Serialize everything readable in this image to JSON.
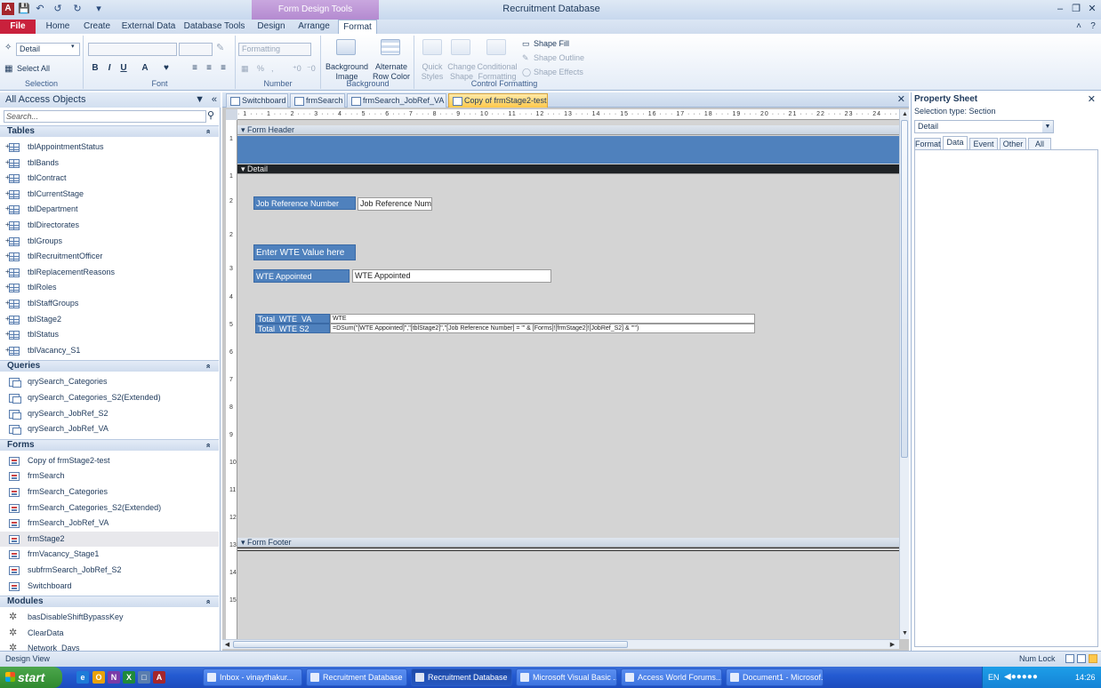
{
  "window": {
    "title": "Recruitment Database",
    "app_icon": "A",
    "context_group": "Form Design Tools"
  },
  "ribbon_tabs": [
    "File",
    "Home",
    "Create",
    "External Data",
    "Database Tools",
    "Design",
    "Arrange",
    "Format"
  ],
  "ribbon": {
    "selection": {
      "label": "Selection",
      "object_combo": "Detail",
      "select_all": "Select All"
    },
    "font": {
      "label": "Font"
    },
    "number": {
      "label": "Number",
      "format_combo": "Formatting"
    },
    "background": {
      "label": "Background",
      "background_image": "Background\nImage",
      "alternate_row_color": "Alternate\nRow Color"
    },
    "control_formatting": {
      "label": "Control Formatting",
      "quick_styles": "Quick\nStyles",
      "change_shape": "Change\nShape",
      "conditional_formatting": "Conditional\nFormatting",
      "shape_fill": "Shape Fill",
      "shape_outline": "Shape Outline",
      "shape_effects": "Shape Effects"
    }
  },
  "nav": {
    "header": "All Access Objects",
    "search_placeholder": "Search...",
    "groups": [
      {
        "title": "Tables",
        "type": "table",
        "items": [
          "tblAppointmentStatus",
          "tblBands",
          "tblContract",
          "tblCurrentStage",
          "tblDepartment",
          "tblDirectorates",
          "tblGroups",
          "tblRecruitmentOfficer",
          "tblReplacementReasons",
          "tblRoles",
          "tblStaffGroups",
          "tblStage2",
          "tblStatus",
          "tblVacancy_S1"
        ]
      },
      {
        "title": "Queries",
        "type": "query",
        "items": [
          "qrySearch_Categories",
          "qrySearch_Categories_S2(Extended)",
          "qrySearch_JobRef_S2",
          "qrySearch_JobRef_VA"
        ]
      },
      {
        "title": "Forms",
        "type": "form",
        "items": [
          "Copy of frmStage2-test",
          "frmSearch",
          "frmSearch_Categories",
          "frmSearch_Categories_S2(Extended)",
          "frmSearch_JobRef_VA",
          "frmStage2",
          "frmVacancy_Stage1",
          "subfrmSearch_JobRef_S2",
          "Switchboard"
        ],
        "selected": "frmStage2"
      },
      {
        "title": "Modules",
        "type": "module",
        "items": [
          "basDisableShiftBypassKey",
          "ClearData",
          "Network_Days"
        ]
      }
    ]
  },
  "doc_tabs": [
    "Switchboard",
    "frmSearch",
    "frmSearch_JobRef_VA",
    "Copy of frmStage2-test"
  ],
  "doc_active_tab": "Copy of frmStage2-test",
  "ruler_text": "· 1 · · · 1 · · · 2 · · · 3 · · · 4 · · · 5 · · · 6 · · · 7 · · · 8 · · · 9 · · · 10 · · · 11 · · · 12 · · · 13 · · · 14 · · · 15 · · · 16 · · · 17 · · · 18 · · · 19 · · · 20 · · · 21 · · · 22 · · · 23 · · · 24 · · · 25 · · · 26 ·",
  "form": {
    "header_section": "Form Header",
    "detail_section": "Detail",
    "footer_section": "Form Footer",
    "controls": {
      "job_ref_label": "Job Reference Number",
      "job_ref_box": "Job Reference Numb",
      "enter_wte_label": "Enter WTE Value here",
      "wte_appointed_label": "WTE Appointed",
      "wte_appointed_box": "WTE Appointed",
      "total_va_label": "Total_WTE_VA",
      "total_va_box": "WTE",
      "total_s2_label": "Total_WTE S2",
      "total_s2_box": "=DSum(\"[WTE Appointed]\",\"[tblStage2]\",\"[Job Reference Number] = '\" & [Forms]![frmStage2]![JobRef_S2] & \"'\")"
    }
  },
  "property_sheet": {
    "title": "Property Sheet",
    "selection_type": "Selection type:  Section",
    "selected_object": "Detail",
    "tabs": [
      "Format",
      "Data",
      "Event",
      "Other",
      "All"
    ],
    "active_tab": "Data"
  },
  "status": {
    "left": "Design View",
    "num_lock": "Num Lock"
  },
  "taskbar": {
    "start": "start",
    "tasks": [
      "Inbox - vinaythakur...",
      "Recruitment Database",
      "Recruitment Database",
      "Microsoft Visual Basic ...",
      "Access World Forums...",
      "Document1 - Microsof..."
    ],
    "active_task": 2,
    "tray_lang": "EN",
    "clock": "14:26"
  },
  "colors": {
    "label_blue": "#4f81bd",
    "file_tab": "#c9213c",
    "context_purple": "#b48ad0",
    "active_doc_tab": "#ffc84a"
  }
}
